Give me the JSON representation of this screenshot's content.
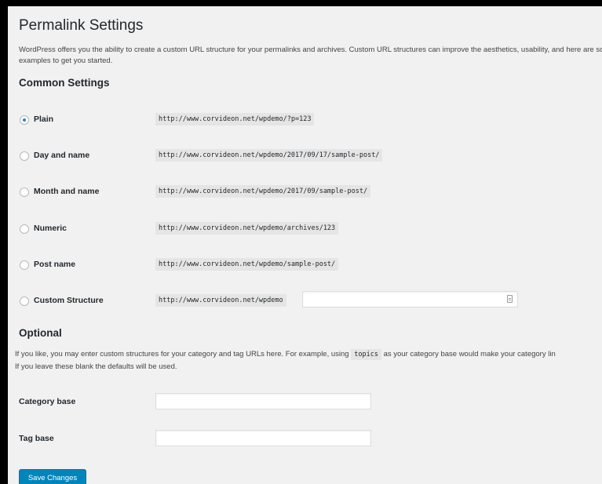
{
  "page": {
    "title": "Permalink Settings",
    "intro": "WordPress offers you the ability to create a custom URL structure for your permalinks and archives. Custom URL structures can improve the aesthetics, usability, and here are some examples to get you started."
  },
  "common": {
    "heading": "Common Settings",
    "options": [
      {
        "label": "Plain",
        "example": "http://www.corvideon.net/wpdemo/?p=123",
        "checked": true
      },
      {
        "label": "Day and name",
        "example": "http://www.corvideon.net/wpdemo/2017/09/17/sample-post/",
        "checked": false
      },
      {
        "label": "Month and name",
        "example": "http://www.corvideon.net/wpdemo/2017/09/sample-post/",
        "checked": false
      },
      {
        "label": "Numeric",
        "example": "http://www.corvideon.net/wpdemo/archives/123",
        "checked": false
      },
      {
        "label": "Post name",
        "example": "http://www.corvideon.net/wpdemo/sample-post/",
        "checked": false
      }
    ],
    "custom": {
      "label": "Custom Structure",
      "prefix": "http://www.corvideon.net/wpdemo",
      "value": "",
      "checked": false
    }
  },
  "optional": {
    "heading": "Optional",
    "text_before": "If you like, you may enter custom structures for your category and tag URLs here. For example, using ",
    "code": "topics",
    "text_after": " as your category base would make your category lin",
    "text_line2": "If you leave these blank the defaults will be used.",
    "category_label": "Category base",
    "category_value": "",
    "tag_label": "Tag base",
    "tag_value": ""
  },
  "actions": {
    "save_label": "Save Changes"
  },
  "colors": {
    "accent": "#0085ba",
    "radio_checked": "#1e8cbe",
    "code_bg": "#e5e5e5",
    "background": "#f1f1f1"
  }
}
